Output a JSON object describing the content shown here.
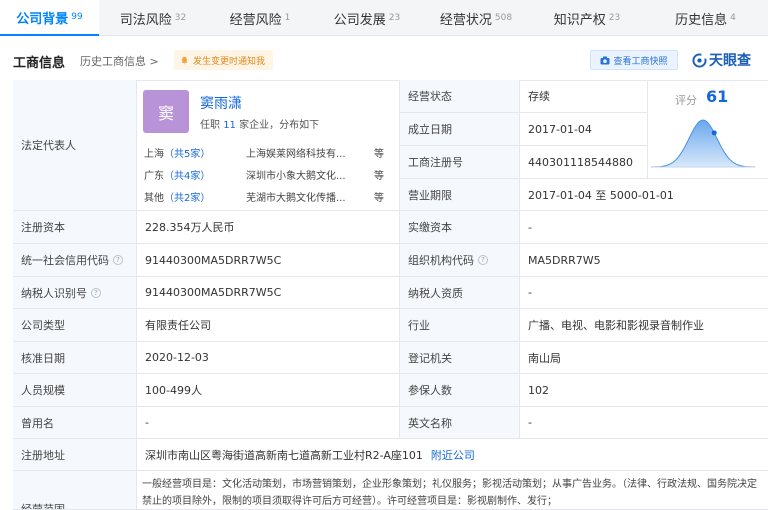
{
  "tabs": [
    {
      "label": "公司背景",
      "count": "99"
    },
    {
      "label": "司法风险",
      "count": "32"
    },
    {
      "label": "经营风险",
      "count": "1"
    },
    {
      "label": "公司发展",
      "count": "23"
    },
    {
      "label": "经营状况",
      "count": "508"
    },
    {
      "label": "知识产权",
      "count": "23"
    },
    {
      "label": "历史信息",
      "count": "4"
    }
  ],
  "header": {
    "title": "工商信息",
    "history_link": "历史工商信息 >",
    "alert": "发生变更时通知我",
    "snapshot_button": "查看工商快照",
    "brand": "天眼查"
  },
  "legal_rep": {
    "label": "法定代表人",
    "avatar_char": "窦",
    "name": "窦雨潇",
    "sub_prefix": "任职",
    "sub_count": "11",
    "sub_suffix": "家企业，分布如下",
    "regions": [
      {
        "name": "上海",
        "count_text": "（共5家）",
        "company": "上海娱莱网络科技有...",
        "etc": "等"
      },
      {
        "name": "广东",
        "count_text": "（共4家）",
        "company": "深圳市小象大鹅文化...",
        "etc": "等"
      },
      {
        "name": "其他",
        "count_text": "（共2家）",
        "company": "芜湖市大鹅文化传播...",
        "etc": "等"
      }
    ]
  },
  "score": {
    "label": "评分",
    "value": "61",
    "position": 0.61
  },
  "rows": {
    "status": {
      "label": "经营状态",
      "value": "存续"
    },
    "founded": {
      "label": "成立日期",
      "value": "2017-01-04"
    },
    "reg_no": {
      "label": "工商注册号",
      "value": "440301118544880"
    },
    "term": {
      "label": "营业期限",
      "value": "2017-01-04  至  5000-01-01"
    },
    "capital": {
      "label": "注册资本",
      "value": "228.354万人民币"
    },
    "paid": {
      "label": "实缴资本",
      "value": "-"
    },
    "credit_code": {
      "label": "统一社会信用代码",
      "value": "91440300MA5DRR7W5C"
    },
    "org_code": {
      "label": "组织机构代码",
      "value": "MA5DRR7W5"
    },
    "tax_id": {
      "label": "纳税人识别号",
      "value": "91440300MA5DRR7W5C"
    },
    "tax_qual": {
      "label": "纳税人资质",
      "value": "-"
    },
    "type": {
      "label": "公司类型",
      "value": "有限责任公司"
    },
    "industry": {
      "label": "行业",
      "value": "广播、电视、电影和影视录音制作业"
    },
    "approved": {
      "label": "核准日期",
      "value": "2020-12-03"
    },
    "authority": {
      "label": "登记机关",
      "value": "南山局"
    },
    "staff": {
      "label": "人员规模",
      "value": "100-499人"
    },
    "insured": {
      "label": "参保人数",
      "value": "102"
    },
    "former": {
      "label": "曾用名",
      "value": "-"
    },
    "english": {
      "label": "英文名称",
      "value": "-"
    },
    "address": {
      "label": "注册地址",
      "value": "深圳市南山区粤海街道高新南七道高新工业村R2-A座101",
      "link": "附近公司"
    },
    "scope": {
      "label": "经营范围",
      "value": "一般经营项目是：文化活动策划，市场营销策划，企业形象策划；礼仪服务；影视活动策划；从事广告业务。（法律、行政法规、国务院决定禁止的项目除外，限制的项目须取得许可后方可经营）。许可经营项目是：影视剧制作、发行；"
    }
  }
}
